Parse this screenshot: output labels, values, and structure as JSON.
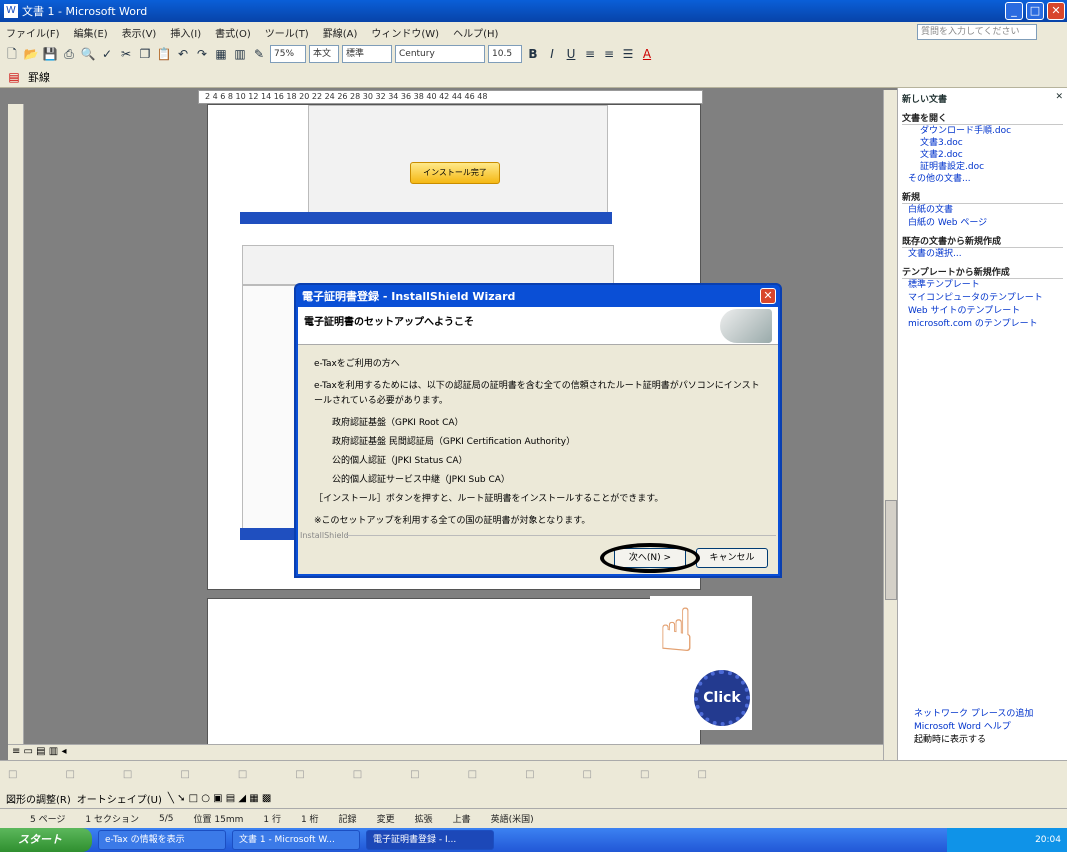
{
  "window": {
    "title": "文書 1 - Microsoft Word",
    "min": "_",
    "max": "□",
    "close": "✕"
  },
  "menu": [
    "ファイル(F)",
    "編集(E)",
    "表示(V)",
    "挿入(I)",
    "書式(O)",
    "ツール(T)",
    "罫線(A)",
    "ウィンドウ(W)",
    "ヘルプ(H)"
  ],
  "help_placeholder": "質問を入力してください",
  "toolbar": {
    "zoom": "75%",
    "view": "本文",
    "style": "標準",
    "font": "Century",
    "size": "10.5",
    "bold": "B",
    "italic": "I",
    "underline": "U",
    "color": "A"
  },
  "toolbar2": {
    "label": "罫線"
  },
  "ruler_text": "2  4  6  8  10  12  14  16  18  20  22  24  26  28  30  32  34  36  38  40  42  44  46  48",
  "install_button": "インストール完了",
  "dialog": {
    "title": "電子証明書登録 - InstallShield Wizard",
    "subtitle": "電子証明書のセットアップへようこそ",
    "intro": "e-Taxをご利用の方へ",
    "body1": "e-Taxを利用するためには、以下の認証局の証明書を含む全ての信頼されたルート証明書がパソコンにインストールされている必要があります。",
    "items": [
      "政府認証基盤（GPKI Root CA）",
      "政府認証基盤 民間認証局（GPKI Certification Authority）",
      "公的個人認証（JPKI Status CA）",
      "公的個人認証サービス中継（JPKI Sub CA）"
    ],
    "body2": "［インストール］ボタンを押すと、ルート証明書をインストールすることができます。",
    "body3": "※このセットアップを利用する全ての国の証明書が対象となります。",
    "brand": "InstallShield",
    "next_label": "次へ(N) >",
    "cancel_label": "キャンセル"
  },
  "click_label": "Click",
  "taskpane": {
    "title": "新しい文書",
    "open_header": "文書を開く",
    "open_items": [
      "ダウンロード手順.doc",
      "文書3.doc",
      "文書2.doc",
      "証明書設定.doc"
    ],
    "more": "その他の文書...",
    "new_header": "新規",
    "new_items": [
      "白紙の文書",
      "白紙の Web ページ"
    ],
    "from_existing_header": "既存の文書から新規作成",
    "from_existing_items": [
      "文書の選択..."
    ],
    "template_header": "テンプレートから新規作成",
    "template_items": [
      "標準テンプレート",
      "マイコンピュータのテンプレート",
      "Web サイトのテンプレート",
      "microsoft.com のテンプレート"
    ],
    "bottom": [
      "ネットワーク プレースの追加",
      "Microsoft Word ヘルプ",
      "起動時に表示する"
    ]
  },
  "status": [
    "5 ページ",
    "1 セクション",
    "5/5",
    "位置 15mm",
    "1 行",
    "1 桁",
    "記録",
    "変更",
    "拡張",
    "上書",
    "英語(米国)"
  ],
  "drawbar": {
    "draw": "図形の調整(R)",
    "autoshape": "オートシェイプ(U)"
  },
  "taskbar": {
    "start": "スタート",
    "tasks": [
      "e-Tax の情報を表示",
      "文書 1 - Microsoft W...",
      "電子証明書登録 - I..."
    ],
    "time": "20:04"
  }
}
